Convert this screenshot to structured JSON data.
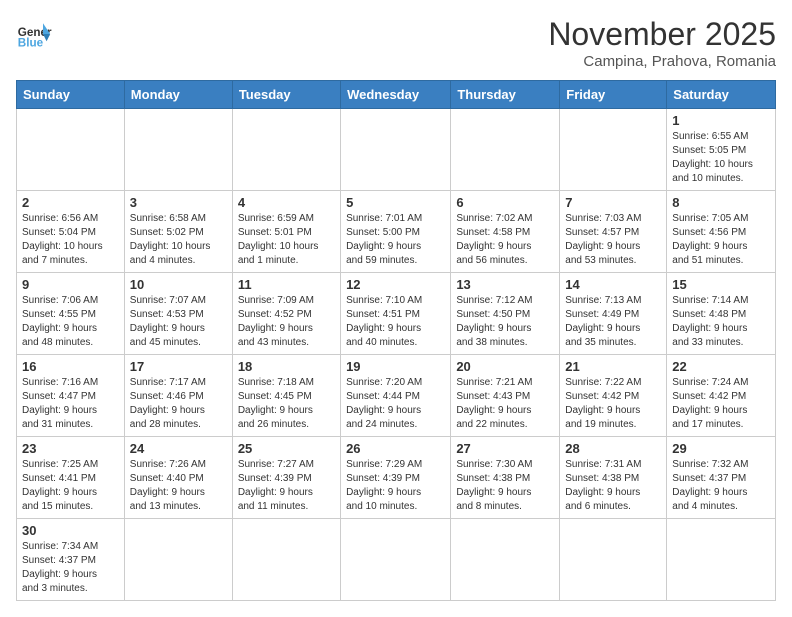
{
  "logo": {
    "text_general": "General",
    "text_blue": "Blue"
  },
  "title": "November 2025",
  "subtitle": "Campina, Prahova, Romania",
  "weekdays": [
    "Sunday",
    "Monday",
    "Tuesday",
    "Wednesday",
    "Thursday",
    "Friday",
    "Saturday"
  ],
  "weeks": [
    [
      {
        "day": "",
        "info": ""
      },
      {
        "day": "",
        "info": ""
      },
      {
        "day": "",
        "info": ""
      },
      {
        "day": "",
        "info": ""
      },
      {
        "day": "",
        "info": ""
      },
      {
        "day": "",
        "info": ""
      },
      {
        "day": "1",
        "info": "Sunrise: 6:55 AM\nSunset: 5:05 PM\nDaylight: 10 hours\nand 10 minutes."
      }
    ],
    [
      {
        "day": "2",
        "info": "Sunrise: 6:56 AM\nSunset: 5:04 PM\nDaylight: 10 hours\nand 7 minutes."
      },
      {
        "day": "3",
        "info": "Sunrise: 6:58 AM\nSunset: 5:02 PM\nDaylight: 10 hours\nand 4 minutes."
      },
      {
        "day": "4",
        "info": "Sunrise: 6:59 AM\nSunset: 5:01 PM\nDaylight: 10 hours\nand 1 minute."
      },
      {
        "day": "5",
        "info": "Sunrise: 7:01 AM\nSunset: 5:00 PM\nDaylight: 9 hours\nand 59 minutes."
      },
      {
        "day": "6",
        "info": "Sunrise: 7:02 AM\nSunset: 4:58 PM\nDaylight: 9 hours\nand 56 minutes."
      },
      {
        "day": "7",
        "info": "Sunrise: 7:03 AM\nSunset: 4:57 PM\nDaylight: 9 hours\nand 53 minutes."
      },
      {
        "day": "8",
        "info": "Sunrise: 7:05 AM\nSunset: 4:56 PM\nDaylight: 9 hours\nand 51 minutes."
      }
    ],
    [
      {
        "day": "9",
        "info": "Sunrise: 7:06 AM\nSunset: 4:55 PM\nDaylight: 9 hours\nand 48 minutes."
      },
      {
        "day": "10",
        "info": "Sunrise: 7:07 AM\nSunset: 4:53 PM\nDaylight: 9 hours\nand 45 minutes."
      },
      {
        "day": "11",
        "info": "Sunrise: 7:09 AM\nSunset: 4:52 PM\nDaylight: 9 hours\nand 43 minutes."
      },
      {
        "day": "12",
        "info": "Sunrise: 7:10 AM\nSunset: 4:51 PM\nDaylight: 9 hours\nand 40 minutes."
      },
      {
        "day": "13",
        "info": "Sunrise: 7:12 AM\nSunset: 4:50 PM\nDaylight: 9 hours\nand 38 minutes."
      },
      {
        "day": "14",
        "info": "Sunrise: 7:13 AM\nSunset: 4:49 PM\nDaylight: 9 hours\nand 35 minutes."
      },
      {
        "day": "15",
        "info": "Sunrise: 7:14 AM\nSunset: 4:48 PM\nDaylight: 9 hours\nand 33 minutes."
      }
    ],
    [
      {
        "day": "16",
        "info": "Sunrise: 7:16 AM\nSunset: 4:47 PM\nDaylight: 9 hours\nand 31 minutes."
      },
      {
        "day": "17",
        "info": "Sunrise: 7:17 AM\nSunset: 4:46 PM\nDaylight: 9 hours\nand 28 minutes."
      },
      {
        "day": "18",
        "info": "Sunrise: 7:18 AM\nSunset: 4:45 PM\nDaylight: 9 hours\nand 26 minutes."
      },
      {
        "day": "19",
        "info": "Sunrise: 7:20 AM\nSunset: 4:44 PM\nDaylight: 9 hours\nand 24 minutes."
      },
      {
        "day": "20",
        "info": "Sunrise: 7:21 AM\nSunset: 4:43 PM\nDaylight: 9 hours\nand 22 minutes."
      },
      {
        "day": "21",
        "info": "Sunrise: 7:22 AM\nSunset: 4:42 PM\nDaylight: 9 hours\nand 19 minutes."
      },
      {
        "day": "22",
        "info": "Sunrise: 7:24 AM\nSunset: 4:42 PM\nDaylight: 9 hours\nand 17 minutes."
      }
    ],
    [
      {
        "day": "23",
        "info": "Sunrise: 7:25 AM\nSunset: 4:41 PM\nDaylight: 9 hours\nand 15 minutes."
      },
      {
        "day": "24",
        "info": "Sunrise: 7:26 AM\nSunset: 4:40 PM\nDaylight: 9 hours\nand 13 minutes."
      },
      {
        "day": "25",
        "info": "Sunrise: 7:27 AM\nSunset: 4:39 PM\nDaylight: 9 hours\nand 11 minutes."
      },
      {
        "day": "26",
        "info": "Sunrise: 7:29 AM\nSunset: 4:39 PM\nDaylight: 9 hours\nand 10 minutes."
      },
      {
        "day": "27",
        "info": "Sunrise: 7:30 AM\nSunset: 4:38 PM\nDaylight: 9 hours\nand 8 minutes."
      },
      {
        "day": "28",
        "info": "Sunrise: 7:31 AM\nSunset: 4:38 PM\nDaylight: 9 hours\nand 6 minutes."
      },
      {
        "day": "29",
        "info": "Sunrise: 7:32 AM\nSunset: 4:37 PM\nDaylight: 9 hours\nand 4 minutes."
      }
    ],
    [
      {
        "day": "30",
        "info": "Sunrise: 7:34 AM\nSunset: 4:37 PM\nDaylight: 9 hours\nand 3 minutes."
      },
      {
        "day": "",
        "info": ""
      },
      {
        "day": "",
        "info": ""
      },
      {
        "day": "",
        "info": ""
      },
      {
        "day": "",
        "info": ""
      },
      {
        "day": "",
        "info": ""
      },
      {
        "day": "",
        "info": ""
      }
    ]
  ]
}
